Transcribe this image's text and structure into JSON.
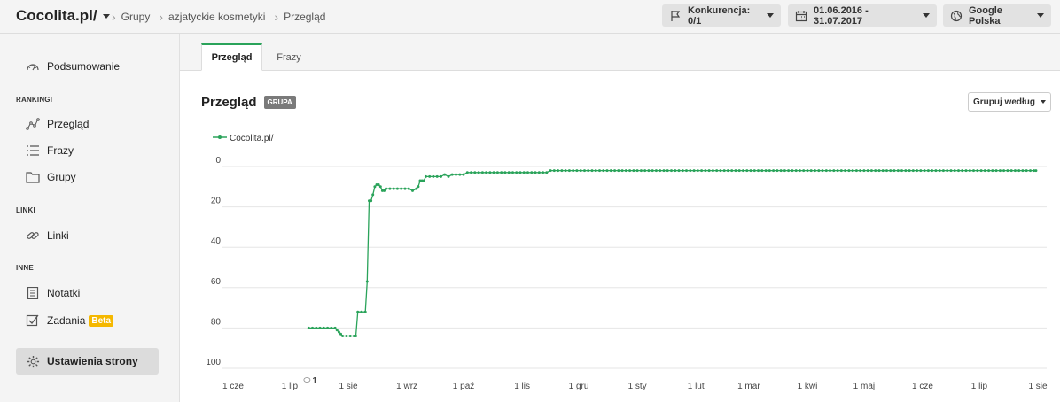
{
  "header": {
    "site_title": "Cocolita.pl/",
    "breadcrumbs": [
      "Grupy",
      "azjatyckie kosmetyki",
      "Przegląd"
    ],
    "competition_label": "Konkurencja: 0/1",
    "date_range": "01.06.2016 - 31.07.2017",
    "search_engine": "Google Polska"
  },
  "sidebar": {
    "summary_label": "Podsumowanie",
    "rankings_heading": "RANKINGI",
    "rankings_items": [
      "Przegląd",
      "Frazy",
      "Grupy"
    ],
    "links_heading": "LINKI",
    "links_items": [
      "Linki"
    ],
    "other_heading": "INNE",
    "notes_label": "Notatki",
    "tasks_label": "Zadania",
    "beta_label": "Beta",
    "settings_label": "Ustawienia strony"
  },
  "tabs": [
    {
      "label": "Przegląd",
      "active": true
    },
    {
      "label": "Frazy",
      "active": false
    }
  ],
  "panel": {
    "title": "Przegląd",
    "badge": "GRUPA",
    "group_by_label": "Grupuj według"
  },
  "colors": {
    "series": "#2aa35a",
    "tab_accent": "#2aa35a",
    "beta": "#f5b800"
  },
  "chart_data": {
    "type": "line",
    "title": "",
    "xlabel": "",
    "ylabel": "",
    "ylim": [
      100,
      0
    ],
    "y_inverted": true,
    "y_ticks": [
      0,
      20,
      40,
      60,
      80,
      100
    ],
    "x_tick_labels": [
      "1 cze",
      "1 lip",
      "1 sie",
      "1 wrz",
      "1 paź",
      "1 lis",
      "1 gru",
      "1 sty",
      "1 lut",
      "1 mar",
      "1 kwi",
      "1 maj",
      "1 cze",
      "1 lip",
      "1 sie"
    ],
    "x_start": "2016-06-01",
    "x_end": "2017-08-01",
    "legend": "top-left",
    "grid": "horizontal",
    "annotation": "1",
    "series": [
      {
        "name": "Cocolita.pl/",
        "points": [
          [
            "2016-07-11",
            80
          ],
          [
            "2016-07-13",
            80
          ],
          [
            "2016-07-15",
            80
          ],
          [
            "2016-07-17",
            80
          ],
          [
            "2016-07-19",
            80
          ],
          [
            "2016-07-21",
            80
          ],
          [
            "2016-07-23",
            80
          ],
          [
            "2016-07-25",
            80
          ],
          [
            "2016-07-26",
            81
          ],
          [
            "2016-07-27",
            82
          ],
          [
            "2016-07-28",
            83
          ],
          [
            "2016-07-29",
            84
          ],
          [
            "2016-07-31",
            84
          ],
          [
            "2016-08-02",
            84
          ],
          [
            "2016-08-04",
            84
          ],
          [
            "2016-08-05",
            84
          ],
          [
            "2016-08-06",
            72
          ],
          [
            "2016-08-08",
            72
          ],
          [
            "2016-08-10",
            72
          ],
          [
            "2016-08-11",
            57
          ],
          [
            "2016-08-12",
            17
          ],
          [
            "2016-08-13",
            17
          ],
          [
            "2016-08-14",
            14
          ],
          [
            "2016-08-15",
            10
          ],
          [
            "2016-08-16",
            9
          ],
          [
            "2016-08-17",
            9
          ],
          [
            "2016-08-18",
            10
          ],
          [
            "2016-08-19",
            12
          ],
          [
            "2016-08-20",
            12
          ],
          [
            "2016-08-21",
            11
          ],
          [
            "2016-08-23",
            11
          ],
          [
            "2016-08-25",
            11
          ],
          [
            "2016-08-27",
            11
          ],
          [
            "2016-08-29",
            11
          ],
          [
            "2016-08-31",
            11
          ],
          [
            "2016-09-02",
            11
          ],
          [
            "2016-09-04",
            12
          ],
          [
            "2016-09-06",
            11
          ],
          [
            "2016-09-07",
            10
          ],
          [
            "2016-09-08",
            7
          ],
          [
            "2016-09-09",
            7
          ],
          [
            "2016-09-10",
            7
          ],
          [
            "2016-09-11",
            5
          ],
          [
            "2016-09-13",
            5
          ],
          [
            "2016-09-15",
            5
          ],
          [
            "2016-09-17",
            5
          ],
          [
            "2016-09-19",
            5
          ],
          [
            "2016-09-21",
            4
          ],
          [
            "2016-09-23",
            5
          ],
          [
            "2016-09-25",
            4
          ],
          [
            "2016-09-27",
            4
          ],
          [
            "2016-09-29",
            4
          ],
          [
            "2016-10-01",
            4
          ],
          [
            "2016-10-03",
            3
          ],
          [
            "2016-10-05",
            3
          ],
          [
            "2016-10-07",
            3
          ],
          [
            "2016-10-09",
            3
          ],
          [
            "2016-10-11",
            3
          ],
          [
            "2016-10-13",
            3
          ],
          [
            "2016-10-15",
            3
          ],
          [
            "2016-10-17",
            3
          ],
          [
            "2016-10-19",
            3
          ],
          [
            "2016-10-21",
            3
          ],
          [
            "2016-10-23",
            3
          ],
          [
            "2016-10-25",
            3
          ],
          [
            "2016-10-27",
            3
          ],
          [
            "2016-10-29",
            3
          ],
          [
            "2016-10-31",
            3
          ],
          [
            "2016-11-02",
            3
          ],
          [
            "2016-11-04",
            3
          ],
          [
            "2016-11-06",
            3
          ],
          [
            "2016-11-08",
            3
          ],
          [
            "2016-11-10",
            3
          ],
          [
            "2016-11-12",
            3
          ],
          [
            "2016-11-14",
            3
          ],
          [
            "2016-11-16",
            2
          ],
          [
            "2016-11-18",
            2
          ],
          [
            "2016-11-20",
            2
          ],
          [
            "2016-11-22",
            2
          ],
          [
            "2016-11-24",
            2
          ],
          [
            "2016-11-26",
            2
          ],
          [
            "2016-11-28",
            2
          ],
          [
            "2016-11-30",
            2
          ],
          [
            "2016-12-02",
            2
          ],
          [
            "2016-12-04",
            2
          ],
          [
            "2016-12-06",
            2
          ],
          [
            "2016-12-08",
            2
          ],
          [
            "2016-12-10",
            2
          ],
          [
            "2016-12-12",
            2
          ],
          [
            "2016-12-14",
            2
          ],
          [
            "2016-12-16",
            2
          ],
          [
            "2016-12-18",
            2
          ],
          [
            "2016-12-20",
            2
          ],
          [
            "2016-12-22",
            2
          ],
          [
            "2016-12-24",
            2
          ],
          [
            "2016-12-26",
            2
          ],
          [
            "2016-12-28",
            2
          ],
          [
            "2016-12-30",
            2
          ],
          [
            "2017-01-01",
            2
          ],
          [
            "2017-01-03",
            2
          ],
          [
            "2017-01-05",
            2
          ],
          [
            "2017-01-07",
            2
          ],
          [
            "2017-01-09",
            2
          ],
          [
            "2017-01-11",
            2
          ],
          [
            "2017-01-13",
            2
          ],
          [
            "2017-01-15",
            2
          ],
          [
            "2017-01-17",
            2
          ],
          [
            "2017-01-19",
            2
          ],
          [
            "2017-01-21",
            2
          ],
          [
            "2017-01-23",
            2
          ],
          [
            "2017-01-25",
            2
          ],
          [
            "2017-01-27",
            2
          ],
          [
            "2017-01-29",
            2
          ],
          [
            "2017-01-31",
            2
          ],
          [
            "2017-02-02",
            2
          ],
          [
            "2017-02-04",
            2
          ],
          [
            "2017-02-06",
            2
          ],
          [
            "2017-02-08",
            2
          ],
          [
            "2017-02-10",
            2
          ],
          [
            "2017-02-12",
            2
          ],
          [
            "2017-02-14",
            2
          ],
          [
            "2017-02-16",
            2
          ],
          [
            "2017-02-18",
            2
          ],
          [
            "2017-02-20",
            2
          ],
          [
            "2017-02-22",
            2
          ],
          [
            "2017-02-24",
            2
          ],
          [
            "2017-02-26",
            2
          ],
          [
            "2017-02-28",
            2
          ],
          [
            "2017-03-02",
            2
          ],
          [
            "2017-03-04",
            2
          ],
          [
            "2017-03-06",
            2
          ],
          [
            "2017-03-08",
            2
          ],
          [
            "2017-03-10",
            2
          ],
          [
            "2017-03-12",
            2
          ],
          [
            "2017-03-14",
            2
          ],
          [
            "2017-03-16",
            2
          ],
          [
            "2017-03-18",
            2
          ],
          [
            "2017-03-20",
            2
          ],
          [
            "2017-03-22",
            2
          ],
          [
            "2017-03-24",
            2
          ],
          [
            "2017-03-26",
            2
          ],
          [
            "2017-03-28",
            2
          ],
          [
            "2017-03-30",
            2
          ],
          [
            "2017-04-01",
            2
          ],
          [
            "2017-04-03",
            2
          ],
          [
            "2017-04-05",
            2
          ],
          [
            "2017-04-07",
            2
          ],
          [
            "2017-04-09",
            2
          ],
          [
            "2017-04-11",
            2
          ],
          [
            "2017-04-13",
            2
          ],
          [
            "2017-04-15",
            2
          ],
          [
            "2017-04-17",
            2
          ],
          [
            "2017-04-19",
            2
          ],
          [
            "2017-04-21",
            2
          ],
          [
            "2017-04-23",
            2
          ],
          [
            "2017-04-25",
            2
          ],
          [
            "2017-04-27",
            2
          ],
          [
            "2017-04-29",
            2
          ],
          [
            "2017-05-01",
            2
          ],
          [
            "2017-05-03",
            2
          ],
          [
            "2017-05-05",
            2
          ],
          [
            "2017-05-07",
            2
          ],
          [
            "2017-05-09",
            2
          ],
          [
            "2017-05-11",
            2
          ],
          [
            "2017-05-13",
            2
          ],
          [
            "2017-05-15",
            2
          ],
          [
            "2017-05-17",
            2
          ],
          [
            "2017-05-19",
            2
          ],
          [
            "2017-05-21",
            2
          ],
          [
            "2017-05-23",
            2
          ],
          [
            "2017-05-25",
            2
          ],
          [
            "2017-05-27",
            2
          ],
          [
            "2017-05-29",
            2
          ],
          [
            "2017-05-31",
            2
          ],
          [
            "2017-06-02",
            2
          ],
          [
            "2017-06-04",
            2
          ],
          [
            "2017-06-06",
            2
          ],
          [
            "2017-06-08",
            2
          ],
          [
            "2017-06-10",
            2
          ],
          [
            "2017-06-12",
            2
          ],
          [
            "2017-06-14",
            2
          ],
          [
            "2017-06-16",
            2
          ],
          [
            "2017-06-18",
            2
          ],
          [
            "2017-06-20",
            2
          ],
          [
            "2017-06-22",
            2
          ],
          [
            "2017-06-24",
            2
          ],
          [
            "2017-06-26",
            2
          ],
          [
            "2017-06-28",
            2
          ],
          [
            "2017-06-30",
            2
          ],
          [
            "2017-07-02",
            2
          ],
          [
            "2017-07-04",
            2
          ],
          [
            "2017-07-06",
            2
          ],
          [
            "2017-07-08",
            2
          ],
          [
            "2017-07-10",
            2
          ],
          [
            "2017-07-12",
            2
          ],
          [
            "2017-07-14",
            2
          ],
          [
            "2017-07-16",
            2
          ],
          [
            "2017-07-18",
            2
          ],
          [
            "2017-07-20",
            2
          ],
          [
            "2017-07-22",
            2
          ],
          [
            "2017-07-24",
            2
          ],
          [
            "2017-07-26",
            2
          ],
          [
            "2017-07-28",
            2
          ],
          [
            "2017-07-30",
            2
          ],
          [
            "2017-07-31",
            2
          ]
        ]
      }
    ]
  }
}
